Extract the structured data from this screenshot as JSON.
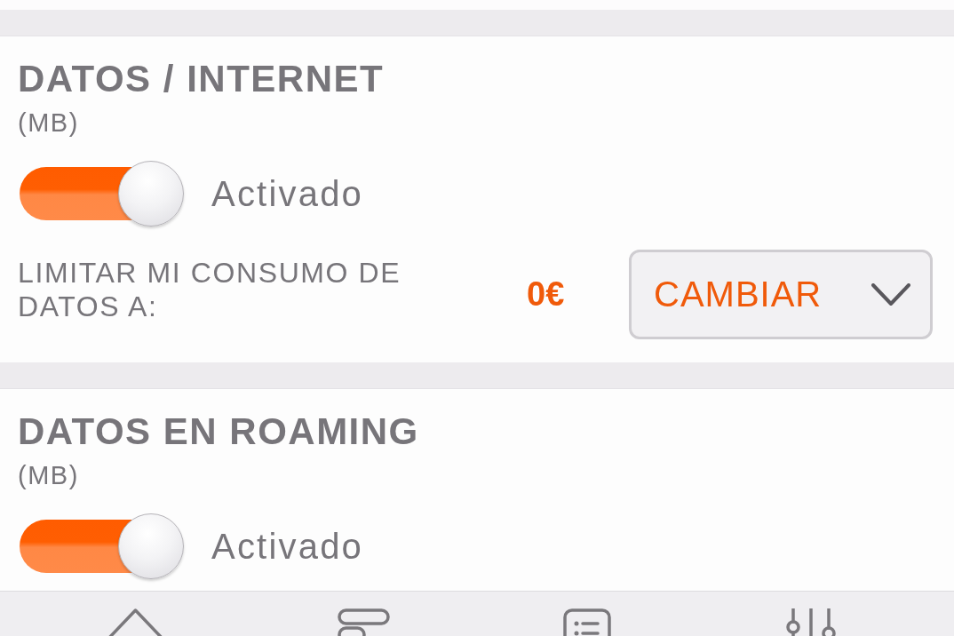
{
  "sections": [
    {
      "title": "DATOS / INTERNET",
      "unit": "(MB)",
      "toggle": {
        "on": true,
        "label": "Activado"
      },
      "limit": {
        "label": "LIMITAR MI CONSUMO DE DATOS A:",
        "value": "0€",
        "button": "CAMBIAR"
      }
    },
    {
      "title": "DATOS EN ROAMING",
      "unit": "(MB)",
      "toggle": {
        "on": true,
        "label": "Activado"
      }
    }
  ]
}
